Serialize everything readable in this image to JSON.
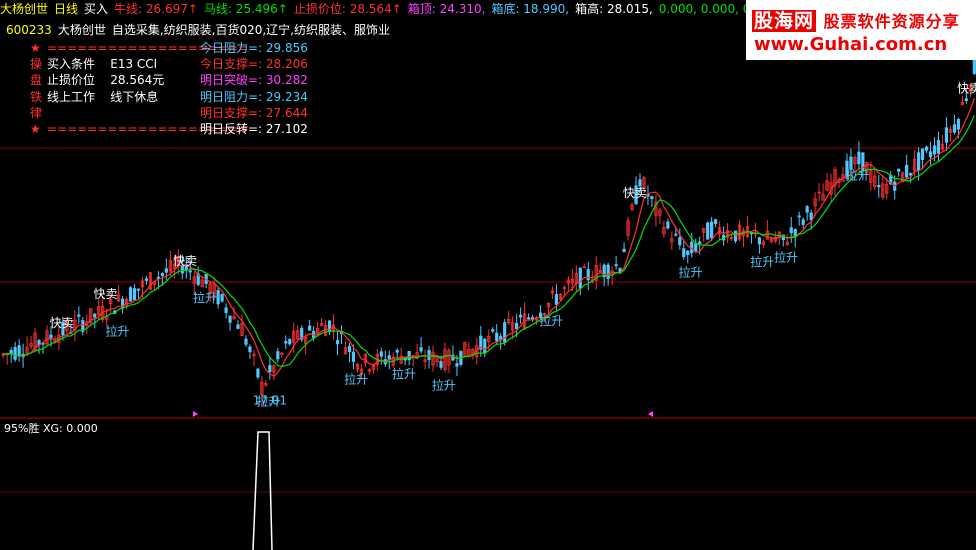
{
  "topbar": {
    "title": "大杨创世",
    "period": "日线",
    "buy": "买入",
    "niu_label": "牛线: 26.697↑",
    "ma_label": "马线: 25.496↑",
    "stop_label": "止损价位: 28.564↑",
    "box_top": "箱顶: 24.310,",
    "box_bottom": "箱底: 18.990,",
    "box_high": "箱高: 28.015,",
    "zeros": "0.000, 0.000, 0.000,"
  },
  "header": {
    "code": "600233",
    "name": "大杨创世",
    "tags": "自选采集,纺织服装,百货020,辽宁,纺织服装、服饰业"
  },
  "info": {
    "rows": [
      {
        "k": "★",
        "v": "====================",
        "c": "#ff3030"
      },
      {
        "k": "操",
        "v": "买入条件    E13 CCI",
        "c": "#ffffff"
      },
      {
        "k": "盘",
        "v": "止损价位    28.564元",
        "c": "#ffffff"
      },
      {
        "k": "铁",
        "v": "线上工作    线下休息",
        "c": "#ffffff"
      },
      {
        "k": "律",
        "v": "",
        "c": "#ffffff"
      },
      {
        "k": "★",
        "v": "====================",
        "c": "#ff3030"
      }
    ]
  },
  "levels": [
    {
      "label": "今日阻力=: 29.856",
      "color": "#50c8ff"
    },
    {
      "label": "今日支撑=: 28.206",
      "color": "#ff3030"
    },
    {
      "label": "明日突破=: 30.282",
      "color": "#ff40ff"
    },
    {
      "label": "明日阻力=: 29.234",
      "color": "#50c8ff"
    },
    {
      "label": "明日支撑=: 27.644",
      "color": "#ff3030"
    },
    {
      "label": "明日反转=: 27.102",
      "color": "#ffffff"
    }
  ],
  "logo": {
    "line1": "股海网",
    "line1b": "股票软件资源分享",
    "line2": "www.Guhai.com.cn"
  },
  "indicator": {
    "label": "95%胜 XG: 0.000"
  },
  "colors": {
    "up": "#ff3030",
    "down": "#50c8ff",
    "niu": "#ff3030",
    "ma": "#00e000",
    "grid": "#a00000",
    "sell": "#ffffff",
    "lift": "#50c8ff"
  },
  "chart_data": {
    "type": "candlestick",
    "series": [
      {
        "name": "牛线",
        "color": "#ff3030"
      },
      {
        "name": "马线",
        "color": "#00e000"
      }
    ],
    "annotations": [
      {
        "text": "快卖",
        "bar": 14
      },
      {
        "text": "快卖",
        "bar": 25
      },
      {
        "text": "快卖",
        "bar": 45
      },
      {
        "text": "拉升",
        "bar": 28
      },
      {
        "text": "拉升",
        "bar": 50
      },
      {
        "text": "拉升",
        "bar": 66
      },
      {
        "text": "拉升",
        "bar": 88
      },
      {
        "text": "拉升",
        "bar": 100
      },
      {
        "text": "拉升",
        "bar": 110
      },
      {
        "text": "拉升",
        "bar": 137
      },
      {
        "text": "拉升",
        "bar": 172
      },
      {
        "text": "拉升",
        "bar": 190
      },
      {
        "text": "拉升",
        "bar": 196
      },
      {
        "text": "拉升",
        "bar": 214
      },
      {
        "text": "快卖",
        "bar": 158
      },
      {
        "text": "快卖",
        "bar": 242
      },
      {
        "text": "17.01",
        "bar": 65
      }
    ],
    "ylim": [
      16.5,
      32
    ]
  }
}
